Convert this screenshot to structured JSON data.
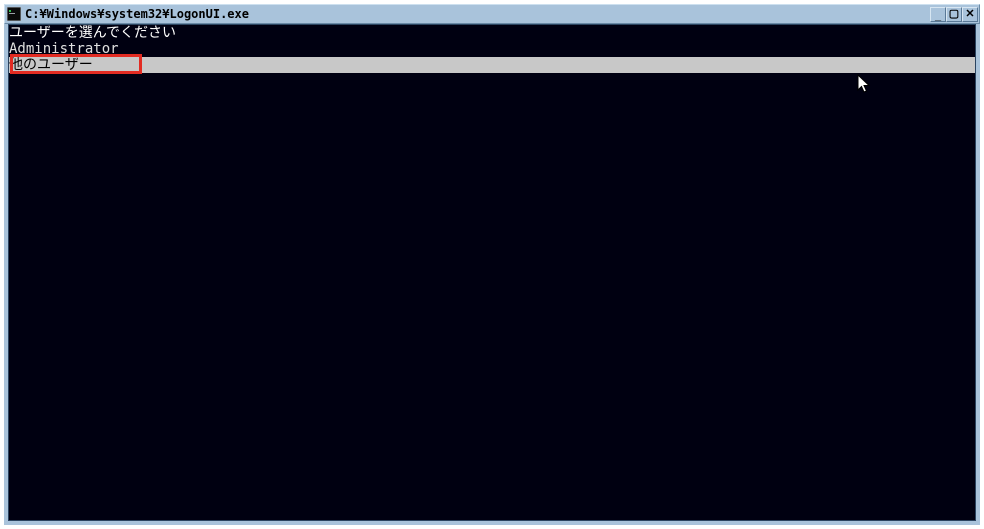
{
  "window": {
    "title": "C:¥Windows¥system32¥LogonUI.exe"
  },
  "logon": {
    "prompt": "ユーザーを選んでください",
    "users": [
      {
        "label": "Administrator",
        "selected": false
      },
      {
        "label": "他のユーザー",
        "selected": true
      }
    ]
  }
}
